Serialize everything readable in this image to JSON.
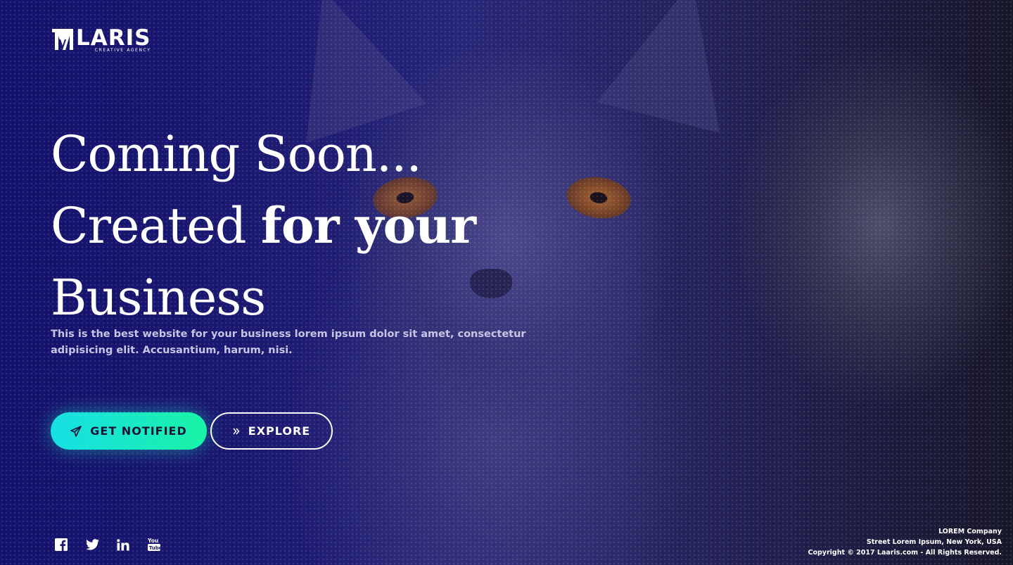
{
  "brand": {
    "name": "LARIS",
    "tagline": "CREATIVE AGENCY"
  },
  "hero": {
    "line1": "Coming Soon...",
    "line2_prefix": "Created ",
    "line2_emphasis": "for your",
    "line3": "Business",
    "description": "This is the best website for your business lorem ipsum dolor sit amet, consectetur adipisicing elit. Accusantium, harum, nisi."
  },
  "actions": {
    "notify_label": "GET NOTIFIED",
    "notify_icon": "paper-plane-icon",
    "explore_label": "EXPLORE",
    "explore_icon": "double-chevron-right-icon"
  },
  "social": [
    {
      "name": "facebook-icon"
    },
    {
      "name": "twitter-icon"
    },
    {
      "name": "linkedin-icon"
    },
    {
      "name": "youtube-icon"
    }
  ],
  "footer": {
    "company": "LOREM Company",
    "address": "Street Lorem Ipsum, New York, USA",
    "copyright": "Copyright © 2017 Laaris.com - All Rights Reserved."
  },
  "colors": {
    "accent_start": "#18dfe6",
    "accent_end": "#19f3a6",
    "overlay": "#1d1a6f",
    "text": "#ffffff"
  }
}
